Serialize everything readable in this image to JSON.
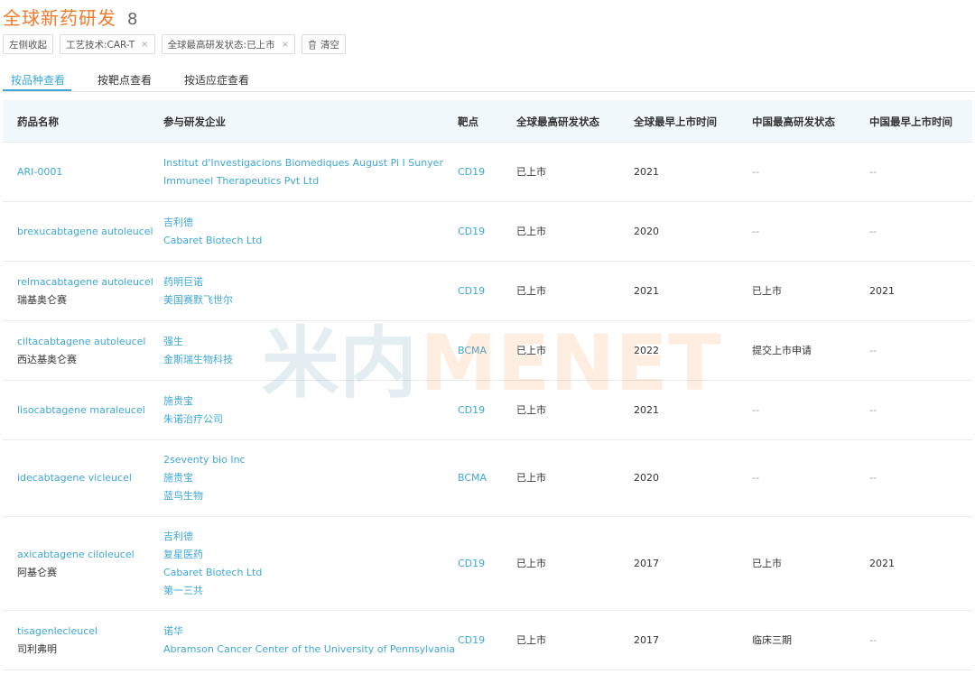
{
  "header": {
    "title": "全球新药研发",
    "count": "8"
  },
  "filters": {
    "collapse_label": "左侧收起",
    "chips": [
      {
        "label": "工艺技术:CAR-T",
        "close": "×"
      },
      {
        "label": "全球最高研发状态:已上市",
        "close": "×"
      }
    ],
    "clear_label": "清空"
  },
  "tabs": [
    "按品种查看",
    "按靶点查看",
    "按适应症查看"
  ],
  "active_tab": 0,
  "table": {
    "columns": [
      "药品名称",
      "参与研发企业",
      "靶点",
      "全球最高研发状态",
      "全球最早上市时间",
      "中国最高研发状态",
      "中国最早上市时间"
    ],
    "rows": [
      {
        "name": "ARI-0001",
        "name_cn": "",
        "companies": [
          "Institut d'Investigacions Biomediques August Pi I Sunyer",
          "Immuneel Therapeutics Pvt Ltd"
        ],
        "target": "CD19",
        "global_status": "已上市",
        "global_date": "2021",
        "china_status": "--",
        "china_date": "--"
      },
      {
        "name": "brexucabtagene autoleucel",
        "name_cn": "",
        "companies": [
          "吉利德",
          "Cabaret Biotech Ltd"
        ],
        "target": "CD19",
        "global_status": "已上市",
        "global_date": "2020",
        "china_status": "--",
        "china_date": "--"
      },
      {
        "name": "relmacabtagene autoleucel",
        "name_cn": "瑞基奥仑赛",
        "companies": [
          "药明巨诺",
          "美国赛默飞世尔"
        ],
        "target": "CD19",
        "global_status": "已上市",
        "global_date": "2021",
        "china_status": "已上市",
        "china_date": "2021"
      },
      {
        "name": "ciltacabtagene autoleucel",
        "name_cn": "西达基奥仑赛",
        "companies": [
          "强生",
          "金斯瑞生物科技"
        ],
        "target": "BCMA",
        "global_status": "已上市",
        "global_date": "2022",
        "china_status": "提交上市申请",
        "china_date": "--"
      },
      {
        "name": "lisocabtagene maraleucel",
        "name_cn": "",
        "companies": [
          "施贵宝",
          "朱诺治疗公司"
        ],
        "target": "CD19",
        "global_status": "已上市",
        "global_date": "2021",
        "china_status": "--",
        "china_date": "--"
      },
      {
        "name": "idecabtagene vicleucel",
        "name_cn": "",
        "companies": [
          "2seventy bio Inc",
          "施贵宝",
          "蓝鸟生物"
        ],
        "target": "BCMA",
        "global_status": "已上市",
        "global_date": "2020",
        "china_status": "--",
        "china_date": "--"
      },
      {
        "name": "axicabtagene ciloleucel",
        "name_cn": "阿基仑赛",
        "companies": [
          "吉利德",
          "复星医药",
          "Cabaret Biotech Ltd",
          "第一三共"
        ],
        "target": "CD19",
        "global_status": "已上市",
        "global_date": "2017",
        "china_status": "已上市",
        "china_date": "2021"
      },
      {
        "name": "tisagenlecleucel",
        "name_cn": "司利弗明",
        "companies": [
          "诺华",
          "Abramson Cancer Center of the University of Pennsylvania"
        ],
        "target": "CD19",
        "global_status": "已上市",
        "global_date": "2017",
        "china_status": "临床三期",
        "china_date": "--"
      }
    ]
  },
  "watermark": {
    "text_cn": "米内",
    "text_en": "MENET"
  },
  "colors": {
    "accent": "#3fa7d6",
    "title": "#ee7a2a",
    "header_bg": "#f1f8fc"
  }
}
